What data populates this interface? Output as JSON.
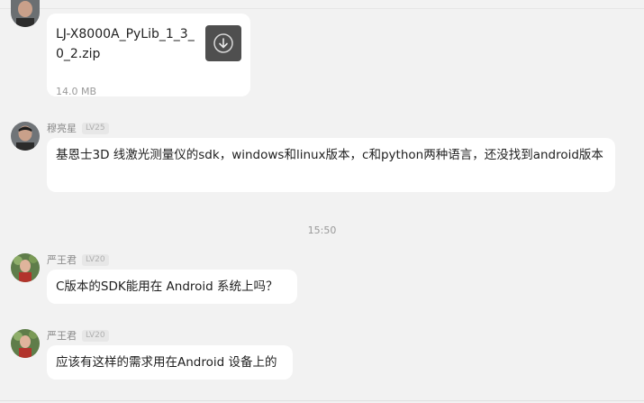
{
  "messages": [
    {
      "kind": "file",
      "file_name": "LJ-X8000A_PyLib_1_3_0_2.zip",
      "file_size": "14.0 MB",
      "action_icon": "download-icon"
    },
    {
      "kind": "text",
      "sender": "穆亮星",
      "level": "LV25",
      "text": "基恩士3D 线激光测量仪的sdk，windows和linux版本，c和python两种语言，还没找到android版本"
    },
    {
      "kind": "time",
      "text": "15:50"
    },
    {
      "kind": "text",
      "sender": "严王君",
      "level": "LV20",
      "text": "C版本的SDK能用在 Android 系统上吗？"
    },
    {
      "kind": "text",
      "sender": "严王君",
      "level": "LV20",
      "text": "应该有这样的需求用在Android 设备上的"
    }
  ]
}
